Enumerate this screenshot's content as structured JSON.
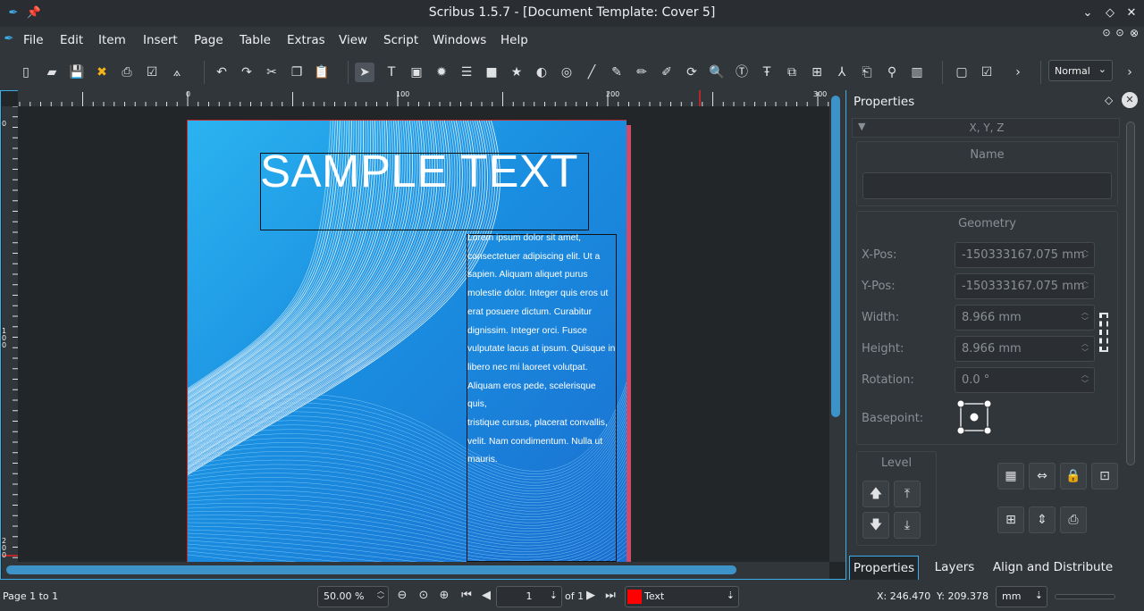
{
  "window": {
    "title": "Scribus 1.5.7 - [Document Template: Cover 5]"
  },
  "menu": [
    "File",
    "Edit",
    "Item",
    "Insert",
    "Page",
    "Table",
    "Extras",
    "View",
    "Script",
    "Windows",
    "Help"
  ],
  "toolbar": {
    "style_value": "Normal"
  },
  "rulers": {
    "h_ticks": [
      "0",
      "100",
      "200",
      "300"
    ],
    "v_ticks": [
      "0",
      "100",
      "200"
    ]
  },
  "document": {
    "heading": "SAMPLE TEXT",
    "body_lines": [
      "Lorem ipsum dolor sit amet,",
      "consectetuer adipiscing elit. Ut a",
      "sapien. Aliquam aliquet purus",
      "molestie dolor. Integer quis eros ut",
      "erat posuere dictum. Curabitur",
      "dignissim. Integer orci. Fusce",
      "vulputate lacus at ipsum. Quisque in",
      "libero nec mi laoreet volutpat.",
      "Aliquam eros pede, scelerisque quis,",
      "tristique cursus, placerat convallis,",
      "velit. Nam condimentum. Nulla ut",
      "mauris."
    ]
  },
  "properties": {
    "title": "Properties",
    "section": "X, Y, Z",
    "name_label": "Name",
    "name_value": "",
    "geometry_label": "Geometry",
    "xpos_label": "X-Pos:",
    "xpos_value": "-150333167.075 mm",
    "ypos_label": "Y-Pos:",
    "ypos_value": "-150333167.075 mm",
    "width_label": "Width:",
    "width_value": "8.966 mm",
    "height_label": "Height:",
    "height_value": "8.966 mm",
    "rotation_label": "Rotation:",
    "rotation_value": "0.0 °",
    "basepoint_label": "Basepoint:",
    "level_label": "Level"
  },
  "tabs": [
    "Properties",
    "Layers",
    "Align and Distribute"
  ],
  "status": {
    "page_info": "Page 1 to 1",
    "zoom": "50.00 %",
    "page_number": "1",
    "page_of": "of 1",
    "layer": "Text",
    "layer_color": "#ff0000",
    "x_coord": "X:  246.470",
    "y_coord": "Y:  209.378",
    "unit": "mm"
  },
  "colors": {
    "accent": "#3daee9",
    "page_gradient_start": "#2bb3f0",
    "page_gradient_end": "#1a6fd0"
  }
}
